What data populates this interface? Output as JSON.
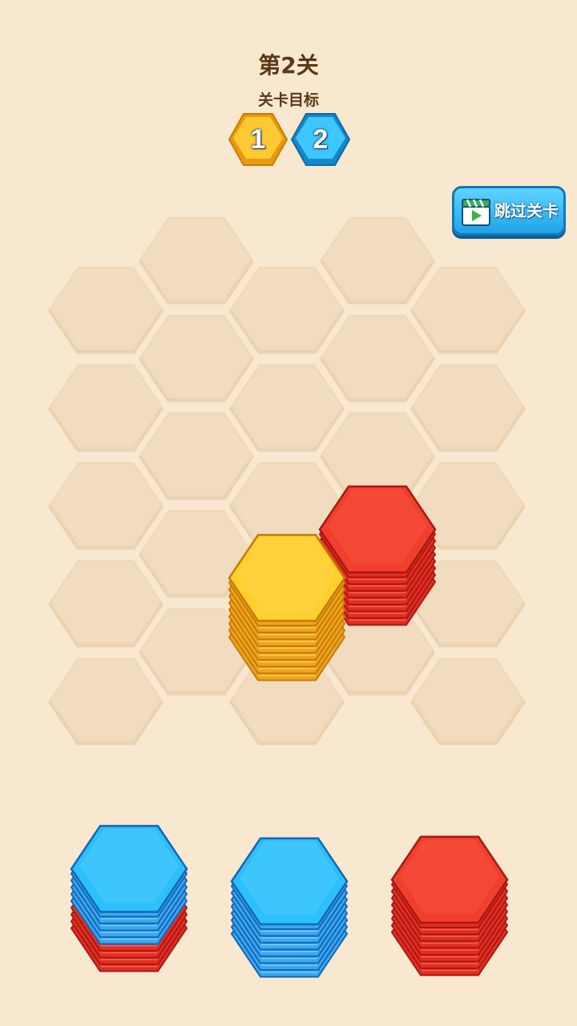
{
  "level": {
    "title": "第2关",
    "goal_label": "关卡目标"
  },
  "goals": [
    {
      "value": "1",
      "color": "#f7b21c"
    },
    {
      "value": "2",
      "color": "#1fb6f2"
    }
  ],
  "skip_button": {
    "label": "跳过关卡",
    "icon": "video-clapper-icon"
  },
  "colors": {
    "background": "#f9e8d0",
    "empty_cell": "#f2dcbf",
    "yellow": "#ffc21a",
    "red": "#f03b2a",
    "blue": "#22b8f6"
  },
  "board": {
    "stacks": [
      {
        "color": "red",
        "count": 8
      },
      {
        "color": "yellow",
        "count": 9
      }
    ]
  },
  "tray": [
    {
      "layers": [
        {
          "color": "red",
          "count": 4
        },
        {
          "color": "blue",
          "count": 5
        }
      ]
    },
    {
      "layers": [
        {
          "color": "blue",
          "count": 8
        }
      ]
    },
    {
      "layers": [
        {
          "color": "red",
          "count": 8
        }
      ]
    }
  ]
}
